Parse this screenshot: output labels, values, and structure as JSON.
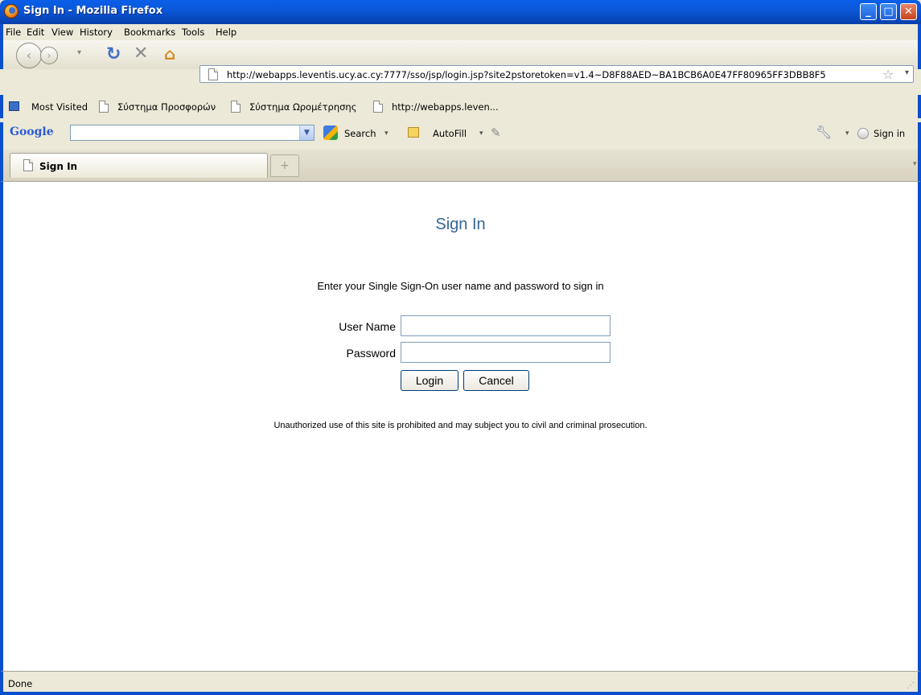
{
  "window": {
    "title": "Sign In - Mozilla Firefox",
    "minimize": "_",
    "maximize": "□",
    "close": "✕"
  },
  "menu": [
    "File",
    "Edit",
    "View",
    "History",
    "Bookmarks",
    "Tools",
    "Help"
  ],
  "nav": {
    "url": "http://webapps.leventis.ucy.ac.cy:7777/sso/jsp/login.jsp?site2pstoretoken=v1.4~D8F88AED~BA1BCB6A0E47FF80965FF3DBB8F5",
    "back_icon": "back-arrow-icon",
    "forward_icon": "forward-arrow-icon",
    "reload_icon": "reload-icon",
    "stop_icon": "stop-icon",
    "home_icon": "home-icon",
    "bookmark_star_icon": "star-icon"
  },
  "bookmarks": [
    "Most Visited",
    "Σύστημα Προσφορών",
    "Σύστημα Ωρομέτρησης",
    "http://webapps.leven..."
  ],
  "google_toolbar": {
    "logo": "Google",
    "search_label": "Search",
    "autofill_label": "AutoFill",
    "signin_label": "Sign in"
  },
  "tabs": [
    {
      "label": "Sign In"
    }
  ],
  "page": {
    "heading": "Sign In",
    "intro": "Enter your Single Sign-On user name and password to sign in",
    "username_label": "User Name",
    "password_label": "Password",
    "username_value": "",
    "password_value": "",
    "login_button": "Login",
    "cancel_button": "Cancel",
    "warning": "Unauthorized use of this site is prohibited and may subject you to civil and criminal prosecution."
  },
  "status": {
    "text": "Done"
  },
  "colors": {
    "heading": "#336699",
    "titlebar": "#0b58d8",
    "chrome": "#ece9d8"
  }
}
